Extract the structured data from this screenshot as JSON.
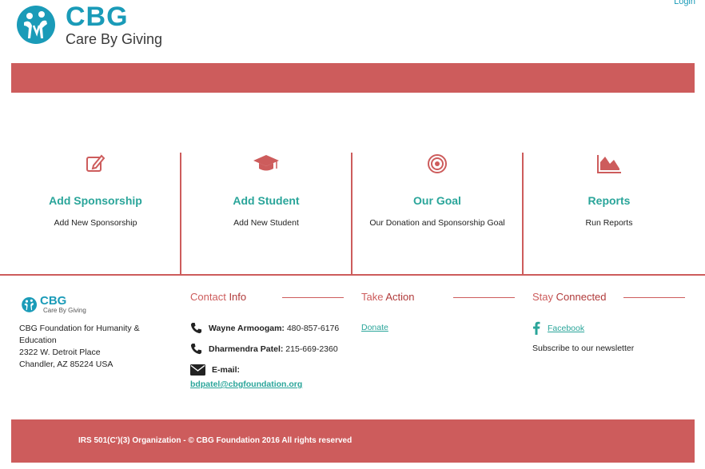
{
  "header": {
    "logo_text": "CBG",
    "logo_subtext": "Care By Giving",
    "login_label": "Login"
  },
  "features": [
    {
      "icon": "edit-icon",
      "title": "Add Sponsorship",
      "desc": "Add New Sponsorship"
    },
    {
      "icon": "graduation-cap-icon",
      "title": "Add Student",
      "desc": "Add New Student"
    },
    {
      "icon": "target-icon",
      "title": "Our Goal",
      "desc": "Our Donation and Sponsorship Goal"
    },
    {
      "icon": "area-chart-icon",
      "title": "Reports",
      "desc": "Run Reports"
    }
  ],
  "footer": {
    "logo_text": "CBG",
    "logo_subtext": "Care By Giving",
    "org_name": "CBG Foundation for Humanity & Education",
    "address_line1": "2322 W. Detroit Place",
    "address_line2": "Chandler, AZ 85224 USA",
    "contact": {
      "heading_prefix": "Contact",
      "heading_accent": "Info",
      "person1_name": "Wayne Armoogam:",
      "person1_phone": "480-857-6176",
      "person2_name": "Dharmendra Patel:",
      "person2_phone": "215-669-2360",
      "email_label": "E-mail:",
      "email": "bdpatel@cbgfoundation.org"
    },
    "action": {
      "heading_prefix": "Take",
      "heading_accent": "Action",
      "donate_label": "Donate"
    },
    "connected": {
      "heading_prefix": "Stay",
      "heading_accent": "Connected",
      "facebook_label": "Facebook",
      "subscribe_text": "Subscribe to our newsletter"
    },
    "copyright": "IRS 501(C')(3) Organization - © CBG Foundation 2016 All rights reserved"
  },
  "colors": {
    "brand_red": "#cd5c5c",
    "brand_teal": "#2aa59a",
    "logo_blue": "#1a9bb8"
  }
}
